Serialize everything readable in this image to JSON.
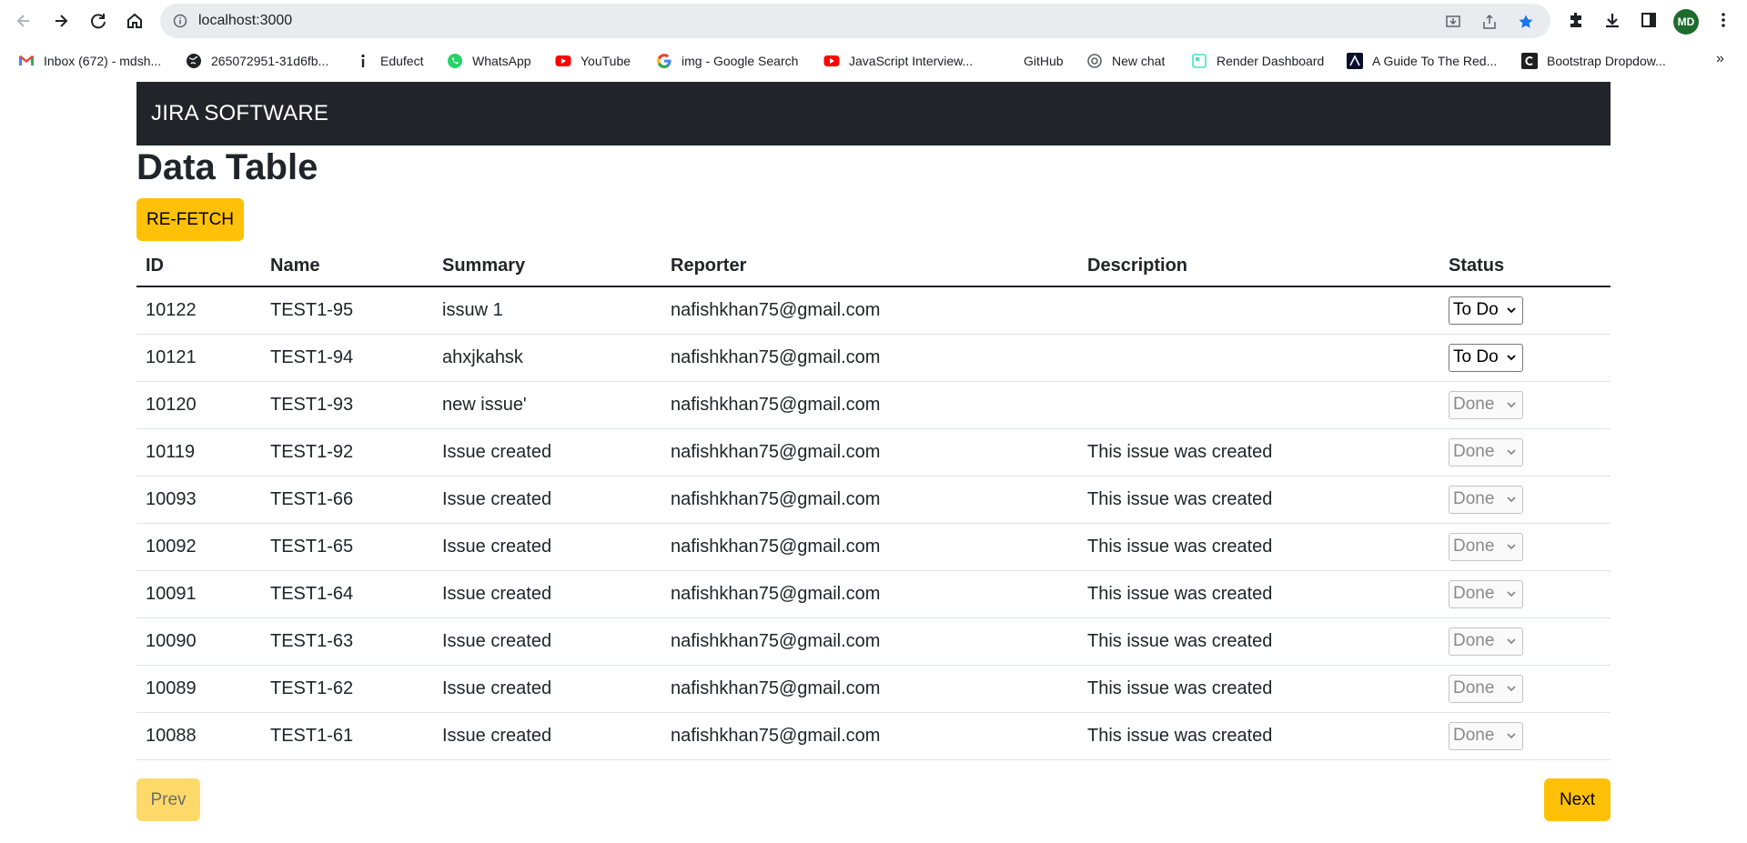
{
  "browser": {
    "url": "localhost:3000",
    "profile_initials": "MD",
    "bookmarks": [
      {
        "label": "Inbox (672) - mdsh...",
        "icon": "gmail-icon"
      },
      {
        "label": "265072951-31d6fb...",
        "icon": "globe-icon"
      },
      {
        "label": "Edufect",
        "icon": "info-icon"
      },
      {
        "label": "WhatsApp",
        "icon": "whatsapp-icon"
      },
      {
        "label": "YouTube",
        "icon": "youtube-icon"
      },
      {
        "label": "img - Google Search",
        "icon": "google-icon"
      },
      {
        "label": "JavaScript Interview...",
        "icon": "youtube-icon"
      },
      {
        "label": "GitHub",
        "icon": "github-icon"
      },
      {
        "label": "New chat",
        "icon": "openai-icon"
      },
      {
        "label": "Render Dashboard",
        "icon": "render-icon"
      },
      {
        "label": "A Guide To The Red...",
        "icon": "redux-icon"
      },
      {
        "label": "Bootstrap Dropdow...",
        "icon": "codecademy-icon"
      }
    ],
    "more_label": "»"
  },
  "navbar": {
    "brand": "JIRA SOFTWARE"
  },
  "page": {
    "title": "Data Table",
    "refetch_label": "RE-FETCH",
    "prev_label": "Prev",
    "next_label": "Next"
  },
  "table": {
    "headers": [
      "ID",
      "Name",
      "Summary",
      "Reporter",
      "Description",
      "Status"
    ],
    "rows": [
      {
        "id": "10122",
        "name": "TEST1-95",
        "summary": "issuw 1",
        "reporter": "nafishkhan75@gmail.com",
        "description": "",
        "status": "To Do",
        "disabled": false
      },
      {
        "id": "10121",
        "name": "TEST1-94",
        "summary": "ahxjkahsk",
        "reporter": "nafishkhan75@gmail.com",
        "description": "",
        "status": "To Do",
        "disabled": false
      },
      {
        "id": "10120",
        "name": "TEST1-93",
        "summary": "new issue'",
        "reporter": "nafishkhan75@gmail.com",
        "description": "",
        "status": "Done",
        "disabled": true
      },
      {
        "id": "10119",
        "name": "TEST1-92",
        "summary": "Issue created",
        "reporter": "nafishkhan75@gmail.com",
        "description": "This issue was created",
        "status": "Done",
        "disabled": true
      },
      {
        "id": "10093",
        "name": "TEST1-66",
        "summary": "Issue created",
        "reporter": "nafishkhan75@gmail.com",
        "description": "This issue was created",
        "status": "Done",
        "disabled": true
      },
      {
        "id": "10092",
        "name": "TEST1-65",
        "summary": "Issue created",
        "reporter": "nafishkhan75@gmail.com",
        "description": "This issue was created",
        "status": "Done",
        "disabled": true
      },
      {
        "id": "10091",
        "name": "TEST1-64",
        "summary": "Issue created",
        "reporter": "nafishkhan75@gmail.com",
        "description": "This issue was created",
        "status": "Done",
        "disabled": true
      },
      {
        "id": "10090",
        "name": "TEST1-63",
        "summary": "Issue created",
        "reporter": "nafishkhan75@gmail.com",
        "description": "This issue was created",
        "status": "Done",
        "disabled": true
      },
      {
        "id": "10089",
        "name": "TEST1-62",
        "summary": "Issue created",
        "reporter": "nafishkhan75@gmail.com",
        "description": "This issue was created",
        "status": "Done",
        "disabled": true
      },
      {
        "id": "10088",
        "name": "TEST1-61",
        "summary": "Issue created",
        "reporter": "nafishkhan75@gmail.com",
        "description": "This issue was created",
        "status": "Done",
        "disabled": true
      }
    ]
  },
  "colors": {
    "navbar_bg": "#212529",
    "warning": "#ffc107",
    "warning_disabled": "#ffda6a",
    "profile_bg": "#1e6b2e",
    "star_blue": "#1a73e8"
  }
}
